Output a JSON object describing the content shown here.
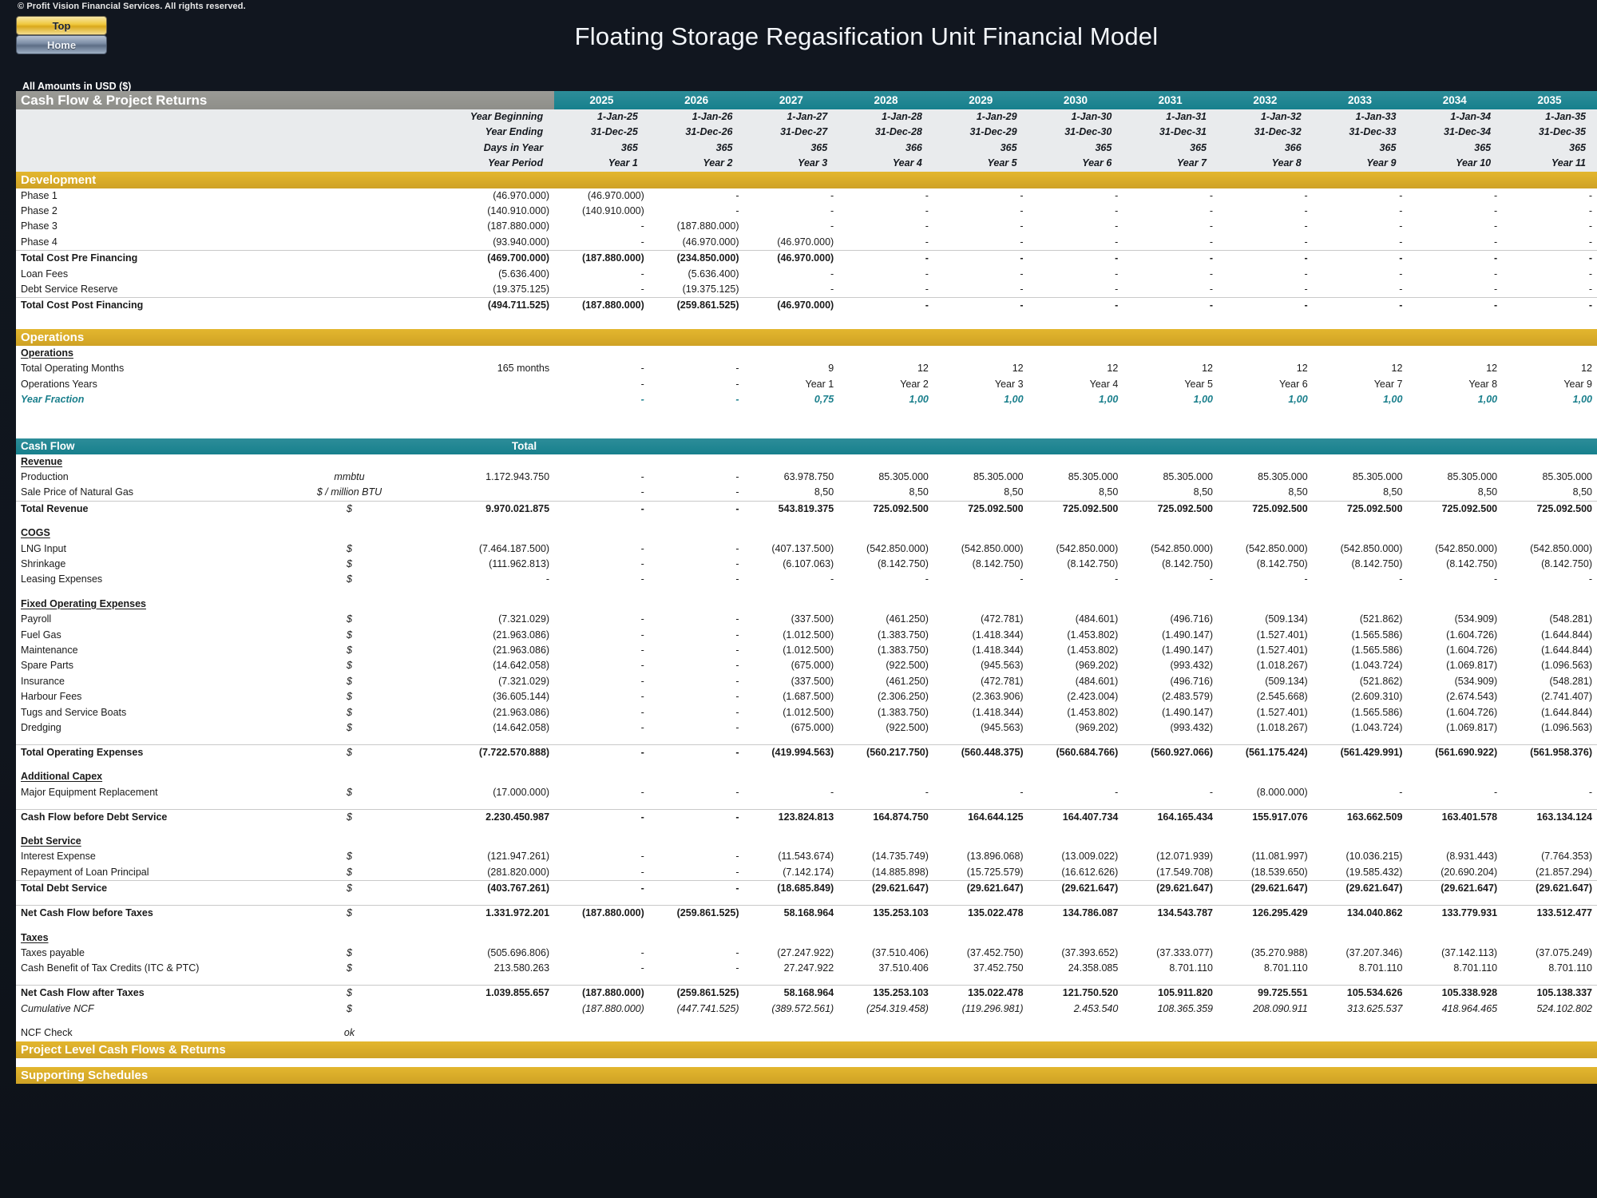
{
  "chrome": {
    "copyright": "© Profit Vision Financial Services. All rights reserved.",
    "btn_top": "Top",
    "btn_home": "Home",
    "title": "Floating Storage Regasification Unit Financial Model",
    "amounts_note": "All Amounts in  USD ($)",
    "accent_teal": "#17808d",
    "accent_gold": "#d7aa28",
    "accent_gray": "#8e8e89"
  },
  "sheet": {
    "title": "Cash Flow & Project Returns",
    "total_caption": "Total",
    "section_development": "Development",
    "section_operations": "Operations",
    "section_cashflow": "Cash Flow",
    "section_project_returns": "Project Level Cash Flows & Returns",
    "section_supporting": "Supporting Schedules"
  },
  "columns": {
    "years": [
      "2025",
      "2026",
      "2027",
      "2028",
      "2029",
      "2030",
      "2031",
      "2032",
      "2033",
      "2034",
      "2035"
    ],
    "header_rows": [
      {
        "label": "Year Beginning",
        "values": [
          "1-Jan-25",
          "1-Jan-26",
          "1-Jan-27",
          "1-Jan-28",
          "1-Jan-29",
          "1-Jan-30",
          "1-Jan-31",
          "1-Jan-32",
          "1-Jan-33",
          "1-Jan-34",
          "1-Jan-35"
        ]
      },
      {
        "label": "Year Ending",
        "values": [
          "31-Dec-25",
          "31-Dec-26",
          "31-Dec-27",
          "31-Dec-28",
          "31-Dec-29",
          "31-Dec-30",
          "31-Dec-31",
          "31-Dec-32",
          "31-Dec-33",
          "31-Dec-34",
          "31-Dec-35"
        ]
      },
      {
        "label": "Days in Year",
        "values": [
          "365",
          "365",
          "365",
          "366",
          "365",
          "365",
          "365",
          "366",
          "365",
          "365",
          "365"
        ]
      },
      {
        "label": "Year Period",
        "values": [
          "Year 1",
          "Year 2",
          "Year 3",
          "Year 4",
          "Year 5",
          "Year 6",
          "Year 7",
          "Year 8",
          "Year 9",
          "Year 10",
          "Year 11"
        ]
      }
    ]
  },
  "development": {
    "rows": [
      {
        "label": "Phase 1",
        "unit": "",
        "total": "(46.970.000)",
        "values": [
          "(46.970.000)",
          "-",
          "-",
          "-",
          "-",
          "-",
          "-",
          "-",
          "-",
          "-",
          "-"
        ]
      },
      {
        "label": "Phase 2",
        "unit": "",
        "total": "(140.910.000)",
        "values": [
          "(140.910.000)",
          "-",
          "-",
          "-",
          "-",
          "-",
          "-",
          "-",
          "-",
          "-",
          "-"
        ]
      },
      {
        "label": "Phase 3",
        "unit": "",
        "total": "(187.880.000)",
        "values": [
          "-",
          "(187.880.000)",
          "-",
          "-",
          "-",
          "-",
          "-",
          "-",
          "-",
          "-",
          "-"
        ]
      },
      {
        "label": "Phase 4",
        "unit": "",
        "total": "(93.940.000)",
        "values": [
          "-",
          "(46.970.000)",
          "(46.970.000)",
          "-",
          "-",
          "-",
          "-",
          "-",
          "-",
          "-",
          "-"
        ]
      }
    ],
    "total_pre": {
      "label": "Total Cost Pre Financing",
      "total": "(469.700.000)",
      "values": [
        "(187.880.000)",
        "(234.850.000)",
        "(46.970.000)",
        "-",
        "-",
        "-",
        "-",
        "-",
        "-",
        "-",
        "-"
      ]
    },
    "financing": [
      {
        "label": "Loan Fees",
        "total": "(5.636.400)",
        "values": [
          "-",
          "(5.636.400)",
          "-",
          "-",
          "-",
          "-",
          "-",
          "-",
          "-",
          "-",
          "-"
        ]
      },
      {
        "label": "Debt Service Reserve",
        "total": "(19.375.125)",
        "values": [
          "-",
          "(19.375.125)",
          "-",
          "-",
          "-",
          "-",
          "-",
          "-",
          "-",
          "-",
          "-"
        ]
      }
    ],
    "total_post": {
      "label": "Total Cost Post Financing",
      "total": "(494.711.525)",
      "values": [
        "(187.880.000)",
        "(259.861.525)",
        "(46.970.000)",
        "-",
        "-",
        "-",
        "-",
        "-",
        "-",
        "-",
        "-"
      ]
    }
  },
  "operations": {
    "subhead": "Operations",
    "rows": [
      {
        "label": "Total Operating Months",
        "total": "165 months",
        "values": [
          "-",
          "-",
          "9",
          "12",
          "12",
          "12",
          "12",
          "12",
          "12",
          "12",
          "12"
        ]
      },
      {
        "label": "Operations Years",
        "total": "",
        "values": [
          "-",
          "-",
          "Year 1",
          "Year 2",
          "Year 3",
          "Year 4",
          "Year 5",
          "Year 6",
          "Year 7",
          "Year 8",
          "Year 9"
        ]
      },
      {
        "label": "Year Fraction",
        "total": "",
        "values": [
          "-",
          "-",
          "0,75",
          "1,00",
          "1,00",
          "1,00",
          "1,00",
          "1,00",
          "1,00",
          "1,00",
          "1,00"
        ]
      }
    ]
  },
  "cashflow": {
    "revenue_head": "Revenue",
    "revenue_rows": [
      {
        "label": "Production",
        "unit": "mmbtu",
        "total": "1.172.943.750",
        "values": [
          "-",
          "-",
          "63.978.750",
          "85.305.000",
          "85.305.000",
          "85.305.000",
          "85.305.000",
          "85.305.000",
          "85.305.000",
          "85.305.000",
          "85.305.000"
        ]
      },
      {
        "label": "Sale Price of Natural Gas",
        "unit": "$ / million BTU",
        "total": "",
        "values": [
          "-",
          "-",
          "8,50",
          "8,50",
          "8,50",
          "8,50",
          "8,50",
          "8,50",
          "8,50",
          "8,50",
          "8,50"
        ]
      }
    ],
    "total_revenue": {
      "label": "Total Revenue",
      "unit": "$",
      "total": "9.970.021.875",
      "values": [
        "-",
        "-",
        "543.819.375",
        "725.092.500",
        "725.092.500",
        "725.092.500",
        "725.092.500",
        "725.092.500",
        "725.092.500",
        "725.092.500",
        "725.092.500"
      ]
    },
    "cogs_head": "COGS",
    "cogs_rows": [
      {
        "label": "LNG Input",
        "unit": "$",
        "total": "(7.464.187.500)",
        "values": [
          "-",
          "-",
          "(407.137.500)",
          "(542.850.000)",
          "(542.850.000)",
          "(542.850.000)",
          "(542.850.000)",
          "(542.850.000)",
          "(542.850.000)",
          "(542.850.000)",
          "(542.850.000)"
        ]
      },
      {
        "label": "Shrinkage",
        "unit": "$",
        "total": "(111.962.813)",
        "values": [
          "-",
          "-",
          "(6.107.063)",
          "(8.142.750)",
          "(8.142.750)",
          "(8.142.750)",
          "(8.142.750)",
          "(8.142.750)",
          "(8.142.750)",
          "(8.142.750)",
          "(8.142.750)"
        ]
      },
      {
        "label": "Leasing Expenses",
        "unit": "$",
        "total": "-",
        "values": [
          "-",
          "-",
          "-",
          "-",
          "-",
          "-",
          "-",
          "-",
          "-",
          "-",
          "-"
        ]
      }
    ],
    "fixed_head": "Fixed Operating Expenses",
    "fixed_rows": [
      {
        "label": "Payroll",
        "unit": "$",
        "total": "(7.321.029)",
        "values": [
          "-",
          "-",
          "(337.500)",
          "(461.250)",
          "(472.781)",
          "(484.601)",
          "(496.716)",
          "(509.134)",
          "(521.862)",
          "(534.909)",
          "(548.281)"
        ]
      },
      {
        "label": "Fuel Gas",
        "unit": "$",
        "total": "(21.963.086)",
        "values": [
          "-",
          "-",
          "(1.012.500)",
          "(1.383.750)",
          "(1.418.344)",
          "(1.453.802)",
          "(1.490.147)",
          "(1.527.401)",
          "(1.565.586)",
          "(1.604.726)",
          "(1.644.844)"
        ]
      },
      {
        "label": "Maintenance",
        "unit": "$",
        "total": "(21.963.086)",
        "values": [
          "-",
          "-",
          "(1.012.500)",
          "(1.383.750)",
          "(1.418.344)",
          "(1.453.802)",
          "(1.490.147)",
          "(1.527.401)",
          "(1.565.586)",
          "(1.604.726)",
          "(1.644.844)"
        ]
      },
      {
        "label": "Spare Parts",
        "unit": "$",
        "total": "(14.642.058)",
        "values": [
          "-",
          "-",
          "(675.000)",
          "(922.500)",
          "(945.563)",
          "(969.202)",
          "(993.432)",
          "(1.018.267)",
          "(1.043.724)",
          "(1.069.817)",
          "(1.096.563)"
        ]
      },
      {
        "label": "Insurance",
        "unit": "$",
        "total": "(7.321.029)",
        "values": [
          "-",
          "-",
          "(337.500)",
          "(461.250)",
          "(472.781)",
          "(484.601)",
          "(496.716)",
          "(509.134)",
          "(521.862)",
          "(534.909)",
          "(548.281)"
        ]
      },
      {
        "label": "Harbour Fees",
        "unit": "$",
        "total": "(36.605.144)",
        "values": [
          "-",
          "-",
          "(1.687.500)",
          "(2.306.250)",
          "(2.363.906)",
          "(2.423.004)",
          "(2.483.579)",
          "(2.545.668)",
          "(2.609.310)",
          "(2.674.543)",
          "(2.741.407)"
        ]
      },
      {
        "label": "Tugs and Service Boats",
        "unit": "$",
        "total": "(21.963.086)",
        "values": [
          "-",
          "-",
          "(1.012.500)",
          "(1.383.750)",
          "(1.418.344)",
          "(1.453.802)",
          "(1.490.147)",
          "(1.527.401)",
          "(1.565.586)",
          "(1.604.726)",
          "(1.644.844)"
        ]
      },
      {
        "label": "Dredging",
        "unit": "$",
        "total": "(14.642.058)",
        "values": [
          "-",
          "-",
          "(675.000)",
          "(922.500)",
          "(945.563)",
          "(969.202)",
          "(993.432)",
          "(1.018.267)",
          "(1.043.724)",
          "(1.069.817)",
          "(1.096.563)"
        ]
      }
    ],
    "total_opex": {
      "label": "Total Operating Expenses",
      "unit": "$",
      "total": "(7.722.570.888)",
      "values": [
        "-",
        "-",
        "(419.994.563)",
        "(560.217.750)",
        "(560.448.375)",
        "(560.684.766)",
        "(560.927.066)",
        "(561.175.424)",
        "(561.429.991)",
        "(561.690.922)",
        "(561.958.376)"
      ]
    },
    "capex_head": "Additional Capex",
    "capex_rows": [
      {
        "label": "Major Equipment Replacement",
        "unit": "$",
        "total": "(17.000.000)",
        "values": [
          "-",
          "-",
          "-",
          "-",
          "-",
          "-",
          "-",
          "(8.000.000)",
          "-",
          "-",
          "-"
        ]
      }
    ],
    "cfbds": {
      "label": "Cash Flow before Debt Service",
      "unit": "$",
      "total": "2.230.450.987",
      "values": [
        "-",
        "-",
        "123.824.813",
        "164.874.750",
        "164.644.125",
        "164.407.734",
        "164.165.434",
        "155.917.076",
        "163.662.509",
        "163.401.578",
        "163.134.124"
      ]
    },
    "debt_head": "Debt Service",
    "debt_rows": [
      {
        "label": "Interest Expense",
        "unit": "$",
        "total": "(121.947.261)",
        "values": [
          "-",
          "-",
          "(11.543.674)",
          "(14.735.749)",
          "(13.896.068)",
          "(13.009.022)",
          "(12.071.939)",
          "(11.081.997)",
          "(10.036.215)",
          "(8.931.443)",
          "(7.764.353)"
        ]
      },
      {
        "label": "Repayment of Loan Principal",
        "unit": "$",
        "total": "(281.820.000)",
        "values": [
          "-",
          "-",
          "(7.142.174)",
          "(14.885.898)",
          "(15.725.579)",
          "(16.612.626)",
          "(17.549.708)",
          "(18.539.650)",
          "(19.585.432)",
          "(20.690.204)",
          "(21.857.294)"
        ]
      }
    ],
    "total_debt": {
      "label": "Total Debt Service",
      "unit": "$",
      "total": "(403.767.261)",
      "values": [
        "-",
        "-",
        "(18.685.849)",
        "(29.621.647)",
        "(29.621.647)",
        "(29.621.647)",
        "(29.621.647)",
        "(29.621.647)",
        "(29.621.647)",
        "(29.621.647)",
        "(29.621.647)"
      ]
    },
    "ncf_before": {
      "label": "Net Cash Flow before Taxes",
      "unit": "$",
      "total": "1.331.972.201",
      "values": [
        "(187.880.000)",
        "(259.861.525)",
        "58.168.964",
        "135.253.103",
        "135.022.478",
        "134.786.087",
        "134.543.787",
        "126.295.429",
        "134.040.862",
        "133.779.931",
        "133.512.477"
      ]
    },
    "taxes_head": "Taxes",
    "taxes_rows": [
      {
        "label": "Taxes payable",
        "unit": "$",
        "total": "(505.696.806)",
        "values": [
          "-",
          "-",
          "(27.247.922)",
          "(37.510.406)",
          "(37.452.750)",
          "(37.393.652)",
          "(37.333.077)",
          "(35.270.988)",
          "(37.207.346)",
          "(37.142.113)",
          "(37.075.249)"
        ]
      },
      {
        "label": "Cash Benefit of Tax Credits (ITC & PTC)",
        "unit": "$",
        "total": "213.580.263",
        "values": [
          "-",
          "-",
          "27.247.922",
          "37.510.406",
          "37.452.750",
          "24.358.085",
          "8.701.110",
          "8.701.110",
          "8.701.110",
          "8.701.110",
          "8.701.110"
        ]
      }
    ],
    "ncf_after": {
      "label": "Net Cash Flow after Taxes",
      "unit": "$",
      "total": "1.039.855.657",
      "values": [
        "(187.880.000)",
        "(259.861.525)",
        "58.168.964",
        "135.253.103",
        "135.022.478",
        "121.750.520",
        "105.911.820",
        "99.725.551",
        "105.534.626",
        "105.338.928",
        "105.138.337"
      ]
    },
    "cumulative": {
      "label": "Cumulative NCF",
      "unit": "$",
      "total": "",
      "values": [
        "(187.880.000)",
        "(447.741.525)",
        "(389.572.561)",
        "(254.319.458)",
        "(119.296.981)",
        "2.453.540",
        "108.365.359",
        "208.090.911",
        "313.625.537",
        "418.964.465",
        "524.102.802"
      ]
    },
    "ncf_check": {
      "label": "NCF Check",
      "unit": "ok",
      "total": "",
      "values": [
        "",
        "",
        "",
        "",
        "",
        "",
        "",
        "",
        "",
        "",
        ""
      ]
    }
  }
}
